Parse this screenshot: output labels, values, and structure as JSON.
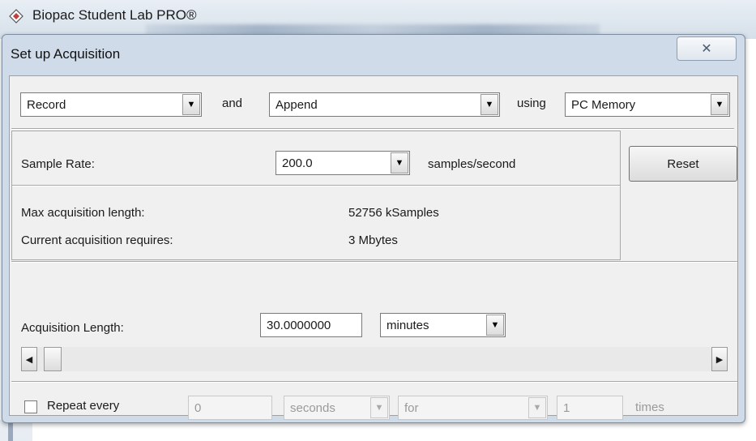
{
  "app": {
    "title": "Biopac Student Lab PRO®"
  },
  "dialog": {
    "title": "Set up Acquisition",
    "close_glyph": "✕"
  },
  "row1": {
    "mode": "Record",
    "and_label": "and",
    "method": "Append",
    "using_label": "using",
    "storage": "PC Memory"
  },
  "sample": {
    "label": "Sample Rate:",
    "value": "200.0",
    "unit": "samples/second",
    "reset_label": "Reset"
  },
  "info": {
    "max_label": "Max acquisition length:",
    "max_value": "52756 kSamples",
    "req_label": "Current acquisition requires:",
    "req_value": "3 Mbytes"
  },
  "length": {
    "label": "Acquisition Length:",
    "value": "30.0000000",
    "unit": "minutes"
  },
  "scroll": {
    "left_glyph": "◀",
    "right_glyph": "▶",
    "arrow_glyph": "▼"
  },
  "repeat": {
    "label": "Repeat every",
    "checked": false,
    "interval": "0",
    "interval_unit": "seconds",
    "for_label": "for",
    "count": "1",
    "times_label": "times"
  },
  "colors": {
    "dialog_frame": "#cfdbe8",
    "client_bg": "#f0f0f0"
  }
}
